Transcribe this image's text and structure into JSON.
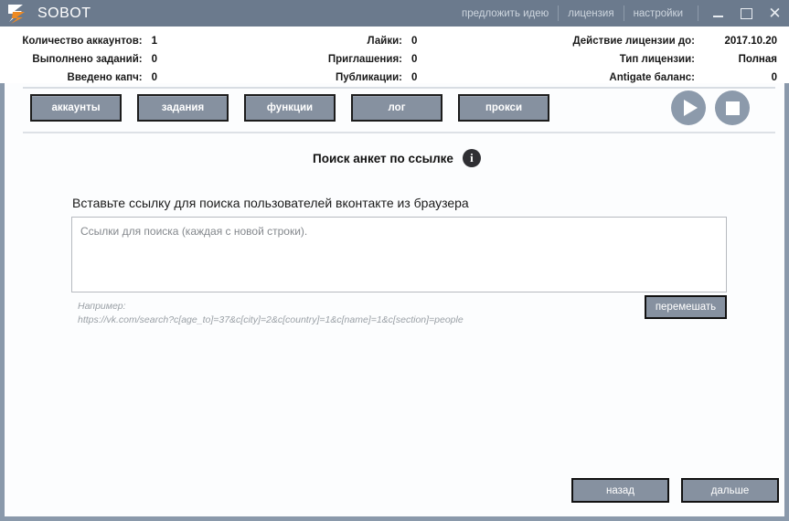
{
  "window": {
    "title": "SOBOT",
    "logo_icon": "sobot-logo-icon",
    "links": [
      {
        "label": "предложить идею",
        "name": "suggest-idea-link"
      },
      {
        "label": "лицензия",
        "name": "license-link"
      },
      {
        "label": "настройки",
        "name": "settings-link"
      }
    ],
    "controls": {
      "minimize": "—",
      "maximize": "□",
      "close": "✕"
    },
    "titlebar_bg": "#6b7a8d",
    "frame_color": "#8a99ab"
  },
  "stats": {
    "column_1": [
      {
        "label": "Количество аккаунтов:",
        "value": "1"
      },
      {
        "label": "Выполнено заданий:",
        "value": "0"
      },
      {
        "label": "Введено капч:",
        "value": "0"
      }
    ],
    "column_2": [
      {
        "label": "Лайки:",
        "value": "0"
      },
      {
        "label": "Приглашения:",
        "value": "0"
      },
      {
        "label": "Публикации:",
        "value": "0"
      }
    ],
    "column_3": [
      {
        "label": "Действие лицензии до:",
        "value": "2017.10.20"
      },
      {
        "label": "Тип лицензии:",
        "value": "Полная"
      },
      {
        "label": "Antigate баланс:",
        "value": "0"
      }
    ]
  },
  "tabs": [
    {
      "label": "аккаунты",
      "name": "tab-accounts"
    },
    {
      "label": "задания",
      "name": "tab-tasks"
    },
    {
      "label": "функции",
      "name": "tab-functions"
    },
    {
      "label": "лог",
      "name": "tab-log"
    },
    {
      "label": "прокси",
      "name": "tab-proxy"
    }
  ],
  "transport": {
    "play_icon": "play-icon",
    "stop_icon": "stop-icon",
    "button_color": "#8c9aab"
  },
  "content": {
    "section_title": "Поиск анкет по ссылке",
    "info_icon_glyph": "i",
    "instruction": "Вставьте ссылку для поиска пользователей вконтакте из браузера",
    "textarea_placeholder": "Ссылки для поиска (каждая с новой строки).",
    "textarea_value": "",
    "example_label": "Например:",
    "example_url": "https://vk.com/search?c[age_to]=37&c[city]=2&c[country]=1&c[name]=1&c[section]=people",
    "shuffle_label": "перемешать"
  },
  "navigation": {
    "back_label": "назад",
    "next_label": "дальше"
  }
}
